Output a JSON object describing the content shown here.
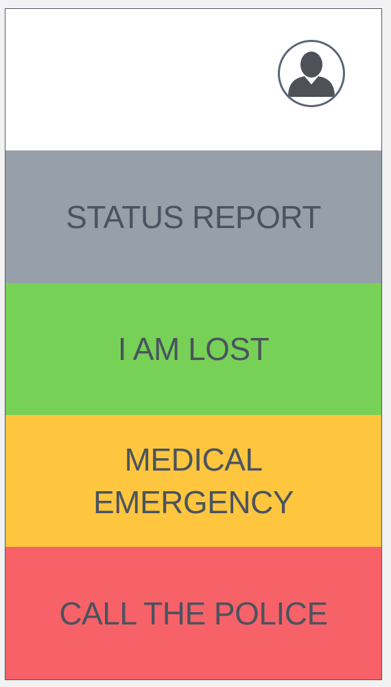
{
  "header": {
    "avatar_icon": "user-avatar-icon"
  },
  "buttons": [
    {
      "id": "status-report",
      "lines": [
        "STATUS REPORT"
      ],
      "color": "#979fa9"
    },
    {
      "id": "i-am-lost",
      "lines": [
        "I AM LOST"
      ],
      "color": "#77d157"
    },
    {
      "id": "medical-emergency",
      "lines": [
        "MEDICAL",
        "EMERGENCY"
      ],
      "color": "#fdc63e"
    },
    {
      "id": "call-the-police",
      "lines": [
        "CALL THE POLICE"
      ],
      "color": "#f76268"
    }
  ],
  "colors": {
    "text": "#4a535f",
    "avatar_ring": "#5a6577",
    "avatar_fill": "#4f5058"
  }
}
